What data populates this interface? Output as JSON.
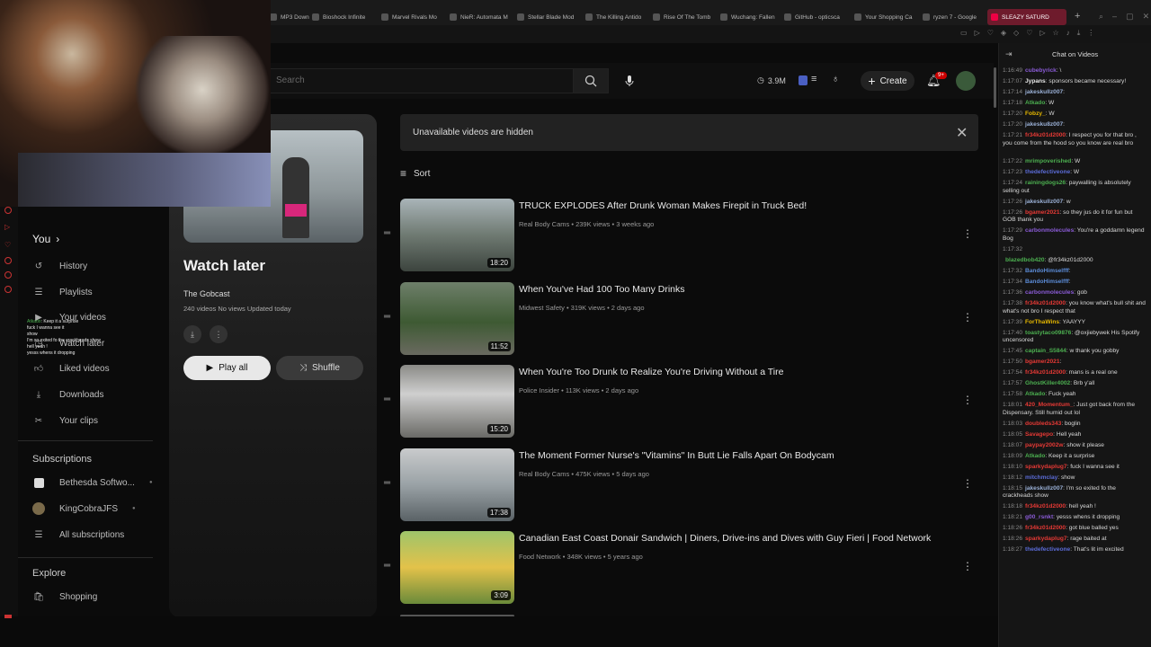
{
  "browser": {
    "tabs": [
      {
        "label": "MP3 Downlo"
      },
      {
        "label": "Bioshock Infinite"
      },
      {
        "label": "Marvel Rivals Mo"
      },
      {
        "label": "NieR: Automata M"
      },
      {
        "label": "Stellar Blade Mod"
      },
      {
        "label": "The Killing Antido"
      },
      {
        "label": "Rise Of The Tomb"
      },
      {
        "label": "Wuchang: Fallen"
      },
      {
        "label": "GitHub - opticsca"
      },
      {
        "label": "Your Shopping Ca"
      },
      {
        "label": "ryzen 7 - Google"
      },
      {
        "label": "SLEAZY SATURD"
      }
    ],
    "new_tab": "+"
  },
  "header": {
    "search_placeholder": "Search",
    "views_count": "3.9M",
    "create_label": "Create",
    "notif_badge": "9+"
  },
  "sidebar": {
    "you_label": "You",
    "items": [
      {
        "label": "History",
        "icon": "history-icon"
      },
      {
        "label": "Playlists",
        "icon": "playlists-icon"
      },
      {
        "label": "Your videos",
        "icon": "your-videos-icon"
      },
      {
        "label": "Watch later",
        "icon": "watch-later-icon"
      },
      {
        "label": "Liked videos",
        "icon": "liked-icon"
      },
      {
        "label": "Downloads",
        "icon": "download-icon"
      },
      {
        "label": "Your clips",
        "icon": "scissors-icon"
      }
    ],
    "subscriptions_label": "Subscriptions",
    "subscriptions": [
      {
        "label": "Bethesda Softwo..."
      },
      {
        "label": "KingCobraJFS"
      },
      {
        "label": "All subscriptions"
      }
    ],
    "explore_label": "Explore",
    "explore": [
      {
        "label": "Shopping"
      }
    ]
  },
  "playlist": {
    "title": "Watch later",
    "owner": "The Gobcast",
    "stats": "240 videos  No views  Updated today",
    "play_all": "Play all",
    "shuffle": "Shuffle"
  },
  "main": {
    "notice": "Unavailable videos are hidden",
    "sort_label": "Sort",
    "videos": [
      {
        "title": "TRUCK EXPLODES After Drunk Woman Makes Firepit in Truck Bed!",
        "channel": "Real Body Cams",
        "meta": "239K views • 3 weeks ago",
        "duration": "18:20"
      },
      {
        "title": "When You've Had 100 Too Many Drinks",
        "channel": "Midwest Safety",
        "meta": "319K views • 2 days ago",
        "duration": "11:52"
      },
      {
        "title": "When You're Too Drunk to Realize You're Driving Without a Tire",
        "channel": "Police Insider",
        "meta": "113K views • 2 days ago",
        "duration": "15:20"
      },
      {
        "title": "The Moment Former Nurse's \"Vitamins\" In Butt Lie Falls Apart On Bodycam",
        "channel": "Real Body Cams",
        "meta": "475K views • 5 days ago",
        "duration": "17:38"
      },
      {
        "title": "Canadian East Coast Donair Sandwich | Diners, Drive-ins and Dives with Guy Fieri | Food Network",
        "channel": "Food Network",
        "meta": "348K views • 5 years ago",
        "duration": "3:09"
      }
    ]
  },
  "chat": {
    "title": "Chat on Videos",
    "messages": [
      {
        "time": "1:16:49",
        "user": "cubebyrick",
        "text": ": \\",
        "color": "#8a5bd6"
      },
      {
        "time": "1:17:07",
        "user": "Jypans",
        "text": ": sponsors became necessary!",
        "color": "#e8e8e8"
      },
      {
        "time": "1:17:14",
        "user": "jakeskullz007",
        "text": ":",
        "color": "#9ab0d6"
      },
      {
        "time": "1:17:18",
        "user": "Atkado",
        "text": ": W",
        "color": "#4caf50"
      },
      {
        "time": "1:17:20",
        "user": "Fobzy_",
        "text": ": W",
        "color": "#e6b800"
      },
      {
        "time": "1:17:20",
        "user": "jakesku8z007",
        "text": ":",
        "color": "#9ab0d6"
      },
      {
        "time": "1:17:21",
        "user": "fr34kz01d2000",
        "text": ": I respect you for that bro , you come from the hood so you know are real bro",
        "color": "#e53935"
      },
      {
        "time": "1:17:22",
        "user": "mrimpoverished",
        "text": ": W",
        "color": "#4caf50"
      },
      {
        "time": "1:17:23",
        "user": "thedefectiveone",
        "text": ": W",
        "color": "#5b6bd6"
      },
      {
        "time": "1:17:24",
        "user": "rainingdogs26",
        "text": ": paywalling is absolutely selling out",
        "color": "#4caf50"
      },
      {
        "time": "1:17:26",
        "user": "jakeskullz007",
        "text": ": w",
        "color": "#9ab0d6"
      },
      {
        "time": "1:17:26",
        "user": "bgamer2021",
        "text": ": so they jus do it for fun but GOB thank you",
        "color": "#e53935"
      },
      {
        "time": "1:17:29",
        "user": "carbonmolecules",
        "text": ": You're a goddamn legend Bog",
        "color": "#8a5bd6"
      },
      {
        "time": "1:17:32",
        "user": "",
        "text": "",
        "color": "#ddd"
      },
      {
        "time": "",
        "user": "blazedbob420",
        "text": ": @fr34kz01d2000",
        "color": "#4caf50"
      },
      {
        "time": "1:17:32",
        "user": "BandoHimselfff",
        "text": ":",
        "color": "#5b8bd6"
      },
      {
        "time": "1:17:34",
        "user": "BandoHimselfff",
        "text": ":",
        "color": "#5b8bd6"
      },
      {
        "time": "1:17:36",
        "user": "carbonmolecules",
        "text": ": gob",
        "color": "#8a5bd6"
      },
      {
        "time": "1:17:38",
        "user": "fr34kz01d2000",
        "text": ": you know what's bull shit and what's not bro I respect that",
        "color": "#e53935"
      },
      {
        "time": "1:17:39",
        "user": "ForThaWins",
        "text": ": YAAYYY",
        "color": "#e6b800"
      },
      {
        "time": "1:17:40",
        "user": "toastytaco09876",
        "text": ": @oxjiebywek His Spotify uncensored",
        "color": "#4caf50"
      },
      {
        "time": "1:17:45",
        "user": "captain_S5844",
        "text": ": w thank you gobby",
        "color": "#4caf50"
      },
      {
        "time": "1:17:50",
        "user": "bgamer2021",
        "text": ":",
        "color": "#e53935"
      },
      {
        "time": "1:17:54",
        "user": "fr34kz01d2000",
        "text": ": mans is a real one",
        "color": "#e53935"
      },
      {
        "time": "1:17:57",
        "user": "GhostKiller4002",
        "text": ": Brb y'all",
        "color": "#4caf50"
      },
      {
        "time": "1:17:58",
        "user": "Atkado",
        "text": ": Fuck yeah",
        "color": "#4caf50"
      },
      {
        "time": "1:18:01",
        "user": "420_Momentum_",
        "text": ": Just got back from the Dispensary. Still humid out lol",
        "color": "#e53935"
      },
      {
        "time": "1:18:03",
        "user": "doubleds343",
        "text": ": boglin",
        "color": "#e53935"
      },
      {
        "time": "1:18:05",
        "user": "Savagepo",
        "text": ": Hell yeah",
        "color": "#e53935"
      },
      {
        "time": "1:18:07",
        "user": "paypay2002w",
        "text": ": show it please",
        "color": "#e53935"
      },
      {
        "time": "1:18:09",
        "user": "Atkado",
        "text": ": Keep it a surprise",
        "color": "#4caf50"
      },
      {
        "time": "1:18:10",
        "user": "sparkydaplug7",
        "text": ": fuck I wanna see it",
        "color": "#e53935"
      },
      {
        "time": "1:18:12",
        "user": "mitchmclay",
        "text": ": show",
        "color": "#5b6bd6"
      },
      {
        "time": "1:18:15",
        "user": "jakeskullz007",
        "text": ": I'm so exited fo the crackheads show",
        "color": "#9ab0d6"
      },
      {
        "time": "1:18:18",
        "user": "fr34kz01d2000",
        "text": ": hell yeah !",
        "color": "#e53935"
      },
      {
        "time": "1:18:21",
        "user": "g00_rsnkt",
        "text": ": yesss whens it dropping",
        "color": "#8a5bd6"
      },
      {
        "time": "1:18:26",
        "user": "fr34kz01d2000",
        "text": ": got blue balled yes",
        "color": "#e53935"
      },
      {
        "time": "1:18:26",
        "user": "sparkydaplug7",
        "text": ": rage baited at",
        "color": "#e53935"
      },
      {
        "time": "1:18:27",
        "user": "thedefectiveone",
        "text": ": That's lit im excited",
        "color": "#5b6bd6"
      }
    ]
  },
  "webcam_chat": [
    {
      "user": "Atkado",
      "text": ": Keep it a surprise"
    },
    {
      "user": "",
      "text": "fuck I wanna see it"
    },
    {
      "user": "",
      "text": "show"
    },
    {
      "user": "",
      "text": "I'm so exited fo the crackheads show"
    },
    {
      "user": "",
      "text": "hell yeah !"
    },
    {
      "user": "",
      "text": "yesss whens it dropping"
    }
  ]
}
